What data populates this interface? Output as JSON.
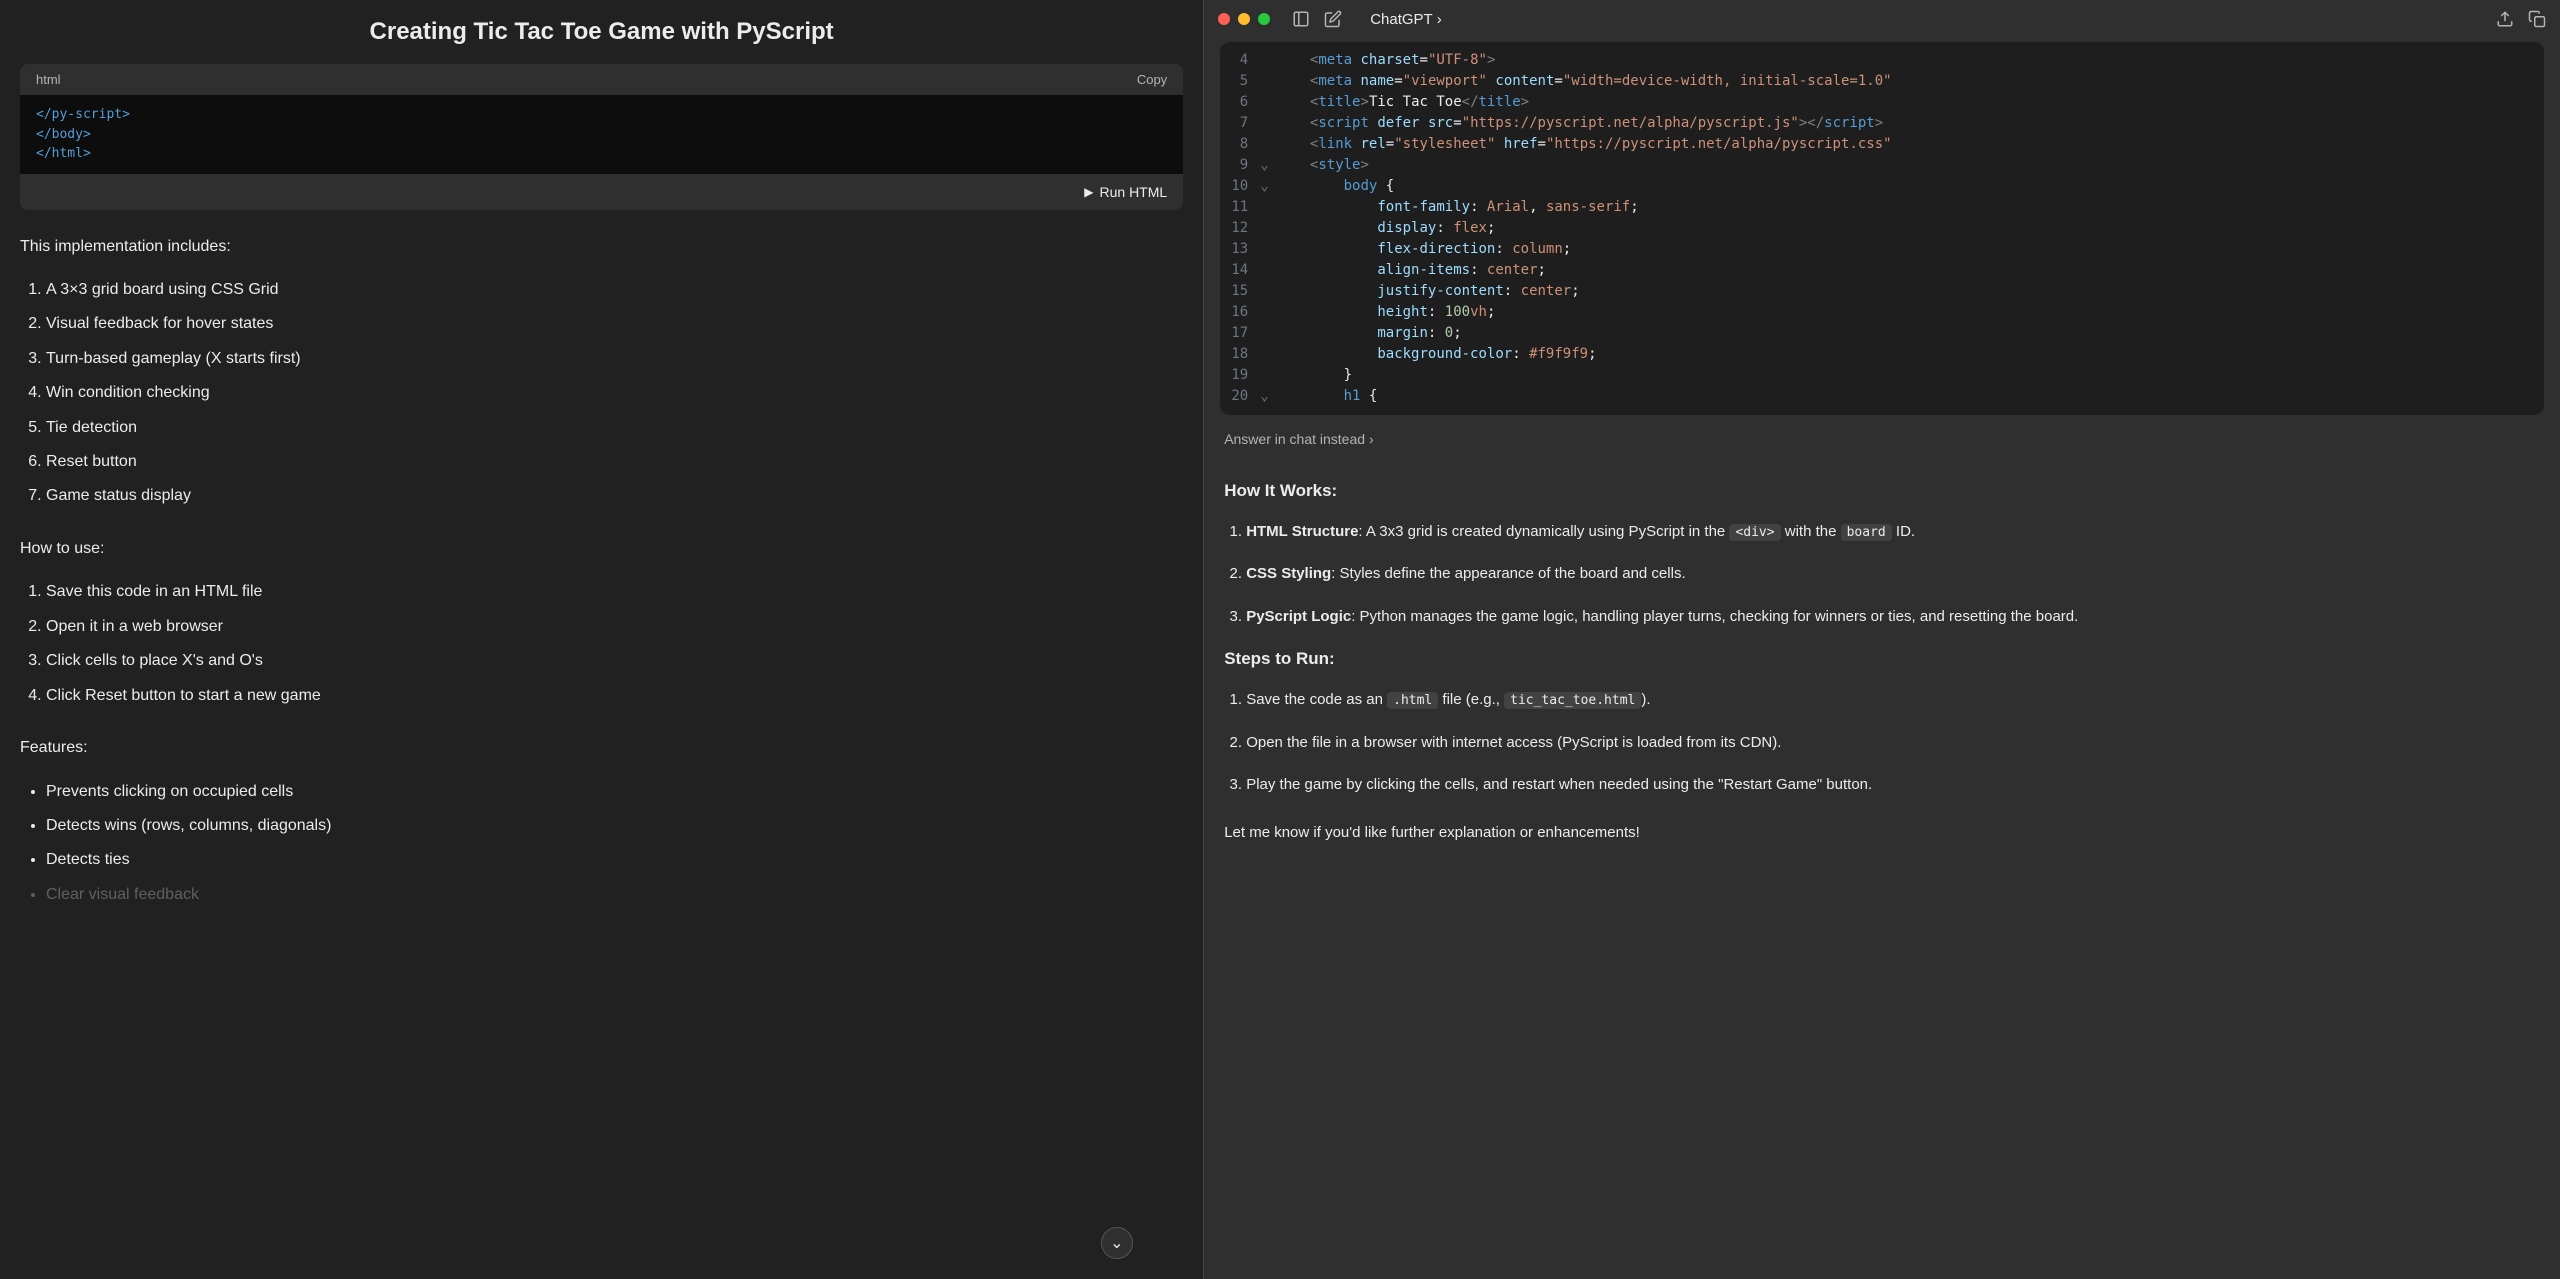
{
  "left": {
    "title": "Creating Tic Tac Toe Game with PyScript",
    "code_lang": "html",
    "copy_label": "Copy",
    "code_snippet_lines": [
      "</py-script>",
      "</body>",
      "</html>"
    ],
    "run_label": "Run HTML",
    "intro_text": "This implementation includes:",
    "impl_list": [
      "A 3×3 grid board using CSS Grid",
      "Visual feedback for hover states",
      "Turn-based gameplay (X starts first)",
      "Win condition checking",
      "Tie detection",
      "Reset button",
      "Game status display"
    ],
    "how_to_use": "How to use:",
    "usage_steps": [
      "Save this code in an HTML file",
      "Open it in a web browser",
      "Click cells to place X's and O's",
      "Click Reset button to start a new game"
    ],
    "features_heading": "Features:",
    "features_list": [
      "Prevents clicking on occupied cells",
      "Detects wins (rows, columns, diagonals)",
      "Detects ties",
      "Clear visual feedback"
    ]
  },
  "right": {
    "window_title": "ChatGPT",
    "editor": {
      "lines": [
        {
          "n": "4",
          "fold": "",
          "html": "    <span class='tok-bracket'>&lt;</span><span class='tok-tag'>meta</span> <span class='tok-attr'>charset</span>=<span class='tok-string'>\"UTF-8\"</span><span class='tok-bracket'>&gt;</span>"
        },
        {
          "n": "5",
          "fold": "",
          "html": "    <span class='tok-bracket'>&lt;</span><span class='tok-tag'>meta</span> <span class='tok-attr'>name</span>=<span class='tok-string'>\"viewport\"</span> <span class='tok-attr'>content</span>=<span class='tok-string'>\"width=device-width, initial-scale=1.0\"</span>"
        },
        {
          "n": "6",
          "fold": "",
          "html": "    <span class='tok-bracket'>&lt;</span><span class='tok-tag'>title</span><span class='tok-bracket'>&gt;</span>Tic Tac Toe<span class='tok-bracket'>&lt;/</span><span class='tok-tag'>title</span><span class='tok-bracket'>&gt;</span>"
        },
        {
          "n": "7",
          "fold": "",
          "html": "    <span class='tok-bracket'>&lt;</span><span class='tok-tag'>script</span> <span class='tok-attr'>defer</span> <span class='tok-attr'>src</span>=<span class='tok-string'>\"https://pyscript.net/alpha/pyscript.js\"</span><span class='tok-bracket'>&gt;&lt;/</span><span class='tok-tag'>script</span><span class='tok-bracket'>&gt;</span>"
        },
        {
          "n": "8",
          "fold": "",
          "html": "    <span class='tok-bracket'>&lt;</span><span class='tok-tag'>link</span> <span class='tok-attr'>rel</span>=<span class='tok-string'>\"stylesheet\"</span> <span class='tok-attr'>href</span>=<span class='tok-string'>\"https://pyscript.net/alpha/pyscript.css\"</span>"
        },
        {
          "n": "9",
          "fold": "⌄",
          "html": "    <span class='tok-bracket'>&lt;</span><span class='tok-tag'>style</span><span class='tok-bracket'>&gt;</span>"
        },
        {
          "n": "10",
          "fold": "⌄",
          "html": "        <span class='tok-tag'>body</span> {"
        },
        {
          "n": "11",
          "fold": "",
          "html": "            <span class='tok-prop'>font-family</span>: <span class='tok-value'>Arial</span>, <span class='tok-value'>sans-serif</span>;"
        },
        {
          "n": "12",
          "fold": "",
          "html": "            <span class='tok-prop'>display</span>: <span class='tok-value'>flex</span>;"
        },
        {
          "n": "13",
          "fold": "",
          "html": "            <span class='tok-prop'>flex-direction</span>: <span class='tok-value'>column</span>;"
        },
        {
          "n": "14",
          "fold": "",
          "html": "            <span class='tok-prop'>align-items</span>: <span class='tok-value'>center</span>;"
        },
        {
          "n": "15",
          "fold": "",
          "html": "            <span class='tok-prop'>justify-content</span>: <span class='tok-value'>center</span>;"
        },
        {
          "n": "16",
          "fold": "",
          "html": "            <span class='tok-prop'>height</span>: <span class='tok-num'>100</span><span class='tok-value'>vh</span>;"
        },
        {
          "n": "17",
          "fold": "",
          "html": "            <span class='tok-prop'>margin</span>: <span class='tok-num'>0</span>;"
        },
        {
          "n": "18",
          "fold": "",
          "html": "            <span class='tok-prop'>background-color</span>: <span class='tok-value'>#f9f9f9</span>;"
        },
        {
          "n": "19",
          "fold": "",
          "html": "        }"
        },
        {
          "n": "20",
          "fold": "⌄",
          "html": "        <span class='tok-tag'>h1</span> {"
        }
      ]
    },
    "answer_link": "Answer in chat instead",
    "how_works_heading": "How It Works:",
    "how_works_items": [
      {
        "bold": "HTML Structure",
        "rest": ": A 3x3 grid is created dynamically using PyScript in the ",
        "code1": "<div>",
        "mid": " with the ",
        "code2": "board",
        "end": " ID."
      },
      {
        "bold": "CSS Styling",
        "rest": ": Styles define the appearance of the board and cells."
      },
      {
        "bold": "PyScript Logic",
        "rest": ": Python manages the game logic, handling player turns, checking for winners or ties, and resetting the board."
      }
    ],
    "steps_heading": "Steps to Run:",
    "steps_items": [
      {
        "pre": "Save the code as an ",
        "code1": ".html",
        "mid": " file (e.g., ",
        "code2": "tic_tac_toe.html",
        "end": ")."
      },
      {
        "text": "Open the file in a browser with internet access (PyScript is loaded from its CDN)."
      },
      {
        "text": "Play the game by clicking the cells, and restart when needed using the \"Restart Game\" button."
      }
    ],
    "footer": "Let me know if you'd like further explanation or enhancements!"
  }
}
